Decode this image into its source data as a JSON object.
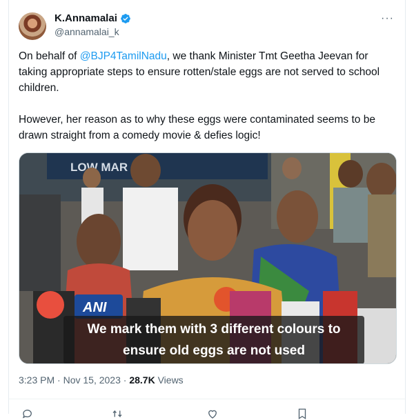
{
  "author": {
    "display_name": "K.Annamalai",
    "handle": "@annamalai_k",
    "verified": true
  },
  "tweet": {
    "text_p1_before": "On behalf of ",
    "mention": "@BJP4TamilNadu",
    "text_p1_after": ", we thank Minister Tmt Geetha Jeevan for taking appropriate steps to ensure rotten/stale eggs are not served to school children.",
    "text_p2": "However, her reason as to why these eggs were contaminated seems to be drawn straight from a comedy movie & defies logic!"
  },
  "media": {
    "caption_line1": "We mark them with 3 different colours to",
    "caption_line2": "ensure old eggs are not used",
    "mic_label": "ANI",
    "shop_sign": "LOW MAR"
  },
  "meta": {
    "time": "3:23 PM",
    "separator": " · ",
    "date": "Nov 15, 2023",
    "separator2": " · ",
    "views_count": "28.7K",
    "views_label": " Views"
  },
  "colors": {
    "link": "#1d9bf0",
    "secondary": "#536471",
    "verified": "#1d9bf0"
  },
  "icons": [
    "verified-badge-icon",
    "more-icon",
    "reply-icon",
    "retweet-icon",
    "like-icon",
    "bookmark-icon"
  ]
}
